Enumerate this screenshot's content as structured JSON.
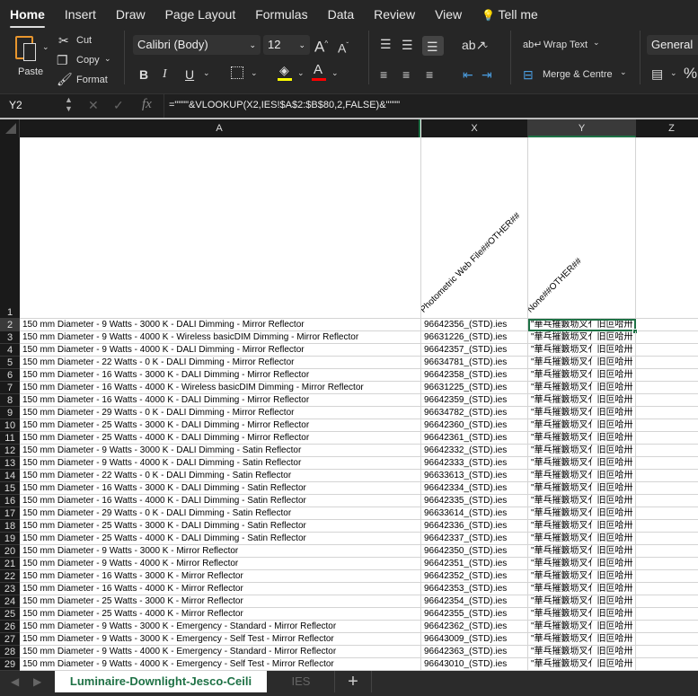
{
  "ribbon_tabs": [
    "Home",
    "Insert",
    "Draw",
    "Page Layout",
    "Formulas",
    "Data",
    "Review",
    "View",
    "Tell me"
  ],
  "clipboard": {
    "paste": "Paste",
    "cut": "Cut",
    "copy": "Copy",
    "format": "Format"
  },
  "font": {
    "name": "Calibri (Body)",
    "size": "12"
  },
  "alignment": {
    "wrap": "Wrap Text",
    "merge": "Merge & Centre"
  },
  "number": {
    "format": "General",
    "percent": "%"
  },
  "formula_bar": {
    "name_box": "Y2",
    "fx": "fx",
    "formula": "=\"\"\"\"&VLOOKUP(X2,IES!$A$2:$B$80,2,FALSE)&\"\"\"\""
  },
  "columns": [
    "A",
    "X",
    "Y",
    "Z"
  ],
  "header_row": {
    "row": "1",
    "x": "Photometric Web File##OTHER##",
    "y": "None##OTHER##"
  },
  "garbled": "\"華乓摧籔坜叉亻旧叵哈卅",
  "rows": [
    [
      "2",
      "150 mm Diameter - 9 Watts - 3000 K - DALI Dimming - Mirror Reflector",
      "96642356_(STD).ies"
    ],
    [
      "3",
      "150 mm Diameter - 9 Watts - 4000 K - Wireless basicDIM Dimming - Mirror Reflector",
      "96631226_(STD).ies"
    ],
    [
      "4",
      "150 mm Diameter - 9 Watts - 4000 K - DALI Dimming - Mirror Reflector",
      "96642357_(STD).ies"
    ],
    [
      "5",
      "150 mm Diameter - 22 Watts - 0 K - DALI Dimming - Mirror Reflector",
      "96634781_(STD).ies"
    ],
    [
      "6",
      "150 mm Diameter - 16 Watts - 3000 K - DALI Dimming - Mirror Reflector",
      "96642358_(STD).ies"
    ],
    [
      "7",
      "150 mm Diameter - 16 Watts - 4000 K - Wireless basicDIM Dimming - Mirror Reflector",
      "96631225_(STD).ies"
    ],
    [
      "8",
      "150 mm Diameter - 16 Watts - 4000 K - DALI Dimming - Mirror Reflector",
      "96642359_(STD).ies"
    ],
    [
      "9",
      "150 mm Diameter - 29 Watts - 0 K - DALI Dimming - Mirror Reflector",
      "96634782_(STD).ies"
    ],
    [
      "10",
      "150 mm Diameter - 25 Watts - 3000 K - DALI Dimming - Mirror Reflector",
      "96642360_(STD).ies"
    ],
    [
      "11",
      "150 mm Diameter - 25 Watts - 4000 K - DALI Dimming - Mirror Reflector",
      "96642361_(STD).ies"
    ],
    [
      "12",
      "150 mm Diameter - 9 Watts - 3000 K - DALI Dimming - Satin Reflector",
      "96642332_(STD).ies"
    ],
    [
      "13",
      "150 mm Diameter - 9 Watts - 4000 K - DALI Dimming - Satin Reflector",
      "96642333_(STD).ies"
    ],
    [
      "14",
      "150 mm Diameter - 22 Watts - 0 K - DALI Dimming - Satin Reflector",
      "96633613_(STD).ies"
    ],
    [
      "15",
      "150 mm Diameter - 16 Watts - 3000 K - DALI Dimming - Satin Reflector",
      "96642334_(STD).ies"
    ],
    [
      "16",
      "150 mm Diameter - 16 Watts - 4000 K - DALI Dimming - Satin Reflector",
      "96642335_(STD).ies"
    ],
    [
      "17",
      "150 mm Diameter - 29 Watts - 0 K - DALI Dimming - Satin Reflector",
      "96633614_(STD).ies"
    ],
    [
      "18",
      "150 mm Diameter - 25 Watts - 3000 K - DALI Dimming - Satin Reflector",
      "96642336_(STD).ies"
    ],
    [
      "19",
      "150 mm Diameter - 25 Watts - 4000 K - DALI Dimming - Satin Reflector",
      "96642337_(STD).ies"
    ],
    [
      "20",
      "150 mm Diameter - 9 Watts - 3000 K - Mirror Reflector",
      "96642350_(STD).ies"
    ],
    [
      "21",
      "150 mm Diameter - 9 Watts - 4000 K - Mirror Reflector",
      "96642351_(STD).ies"
    ],
    [
      "22",
      "150 mm Diameter - 16 Watts - 3000 K - Mirror Reflector",
      "96642352_(STD).ies"
    ],
    [
      "23",
      "150 mm Diameter - 16 Watts - 4000 K - Mirror Reflector",
      "96642353_(STD).ies"
    ],
    [
      "24",
      "150 mm Diameter - 25 Watts - 3000 K - Mirror Reflector",
      "96642354_(STD).ies"
    ],
    [
      "25",
      "150 mm Diameter - 25 Watts - 4000 K - Mirror Reflector",
      "96642355_(STD).ies"
    ],
    [
      "26",
      "150 mm Diameter - 9 Watts - 3000 K - Emergency - Standard - Mirror Reflector",
      "96642362_(STD).ies"
    ],
    [
      "27",
      "150 mm Diameter - 9 Watts - 3000 K - Emergency - Self Test - Mirror Reflector",
      "96643009_(STD).ies"
    ],
    [
      "28",
      "150 mm Diameter - 9 Watts - 4000 K - Emergency - Standard - Mirror Reflector",
      "96642363_(STD).ies"
    ],
    [
      "29",
      "150 mm Diameter - 9 Watts - 4000 K - Emergency - Self Test - Mirror Reflector",
      "96643010_(STD).ies"
    ]
  ],
  "sheets": [
    "Luminaire-Downlight-Jesco-Ceili",
    "IES"
  ],
  "add_sheet": "+",
  "colors": {
    "accent": "#1e7145",
    "fill": "#ffff00",
    "font": "#ff0000"
  }
}
